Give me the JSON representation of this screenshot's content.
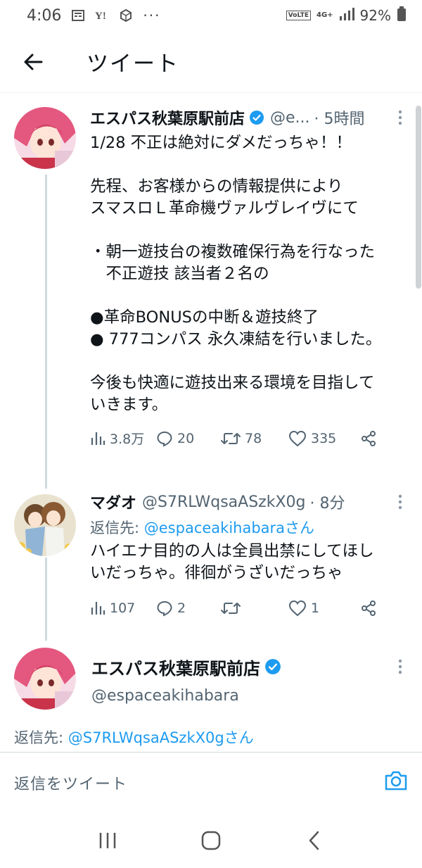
{
  "status_bar": {
    "time": "4:06",
    "battery": "92%",
    "volte": "VoLTE",
    "network": "4G+",
    "more": "···"
  },
  "header": {
    "title": "ツイート"
  },
  "tweets": [
    {
      "name": "エスパス秋葉原駅前店",
      "handle": "@e...",
      "time": "· 5時間",
      "text": "1/28 不正は絶対にダメだっちゃ！！\n\n先程、お客様からの情報提供により\nスマスロＬ革命機ヴァルヴレイヴにて\n\n・朝一遊技台の複数確保行為を行なった\n　不正遊技 該当者２名の\n\n●革命BONUSの中断＆遊技終了\n● 777コンパス 永久凍結を行いました。\n\n今後も快適に遊技出来る環境を目指して\nいきます。",
      "views": "3.8万",
      "replies": "20",
      "retweets": "78",
      "likes": "335"
    },
    {
      "name": "マダオ",
      "handle": "@S7RLWqsaASzkX0g",
      "time": "· 8分",
      "reply_label": "返信先: ",
      "reply_handle": "@espaceakihabaraさん",
      "text": "ハイエナ目的の人は全員出禁にしてほし\nいだっちゃ。徘徊がうざいだっちゃ",
      "views": "107",
      "replies": "2",
      "retweets": "",
      "likes": "1"
    },
    {
      "name": "エスパス秋葉原駅前店",
      "handle": "@espaceakihabara",
      "reply_label": "返信先: ",
      "reply_handle": "@S7RLWqsaASzkX0gさん"
    }
  ],
  "compose": {
    "placeholder": "返信をツイート"
  },
  "colors": {
    "accent": "#1d9bf0",
    "muted": "#536471",
    "text": "#0f1419"
  }
}
